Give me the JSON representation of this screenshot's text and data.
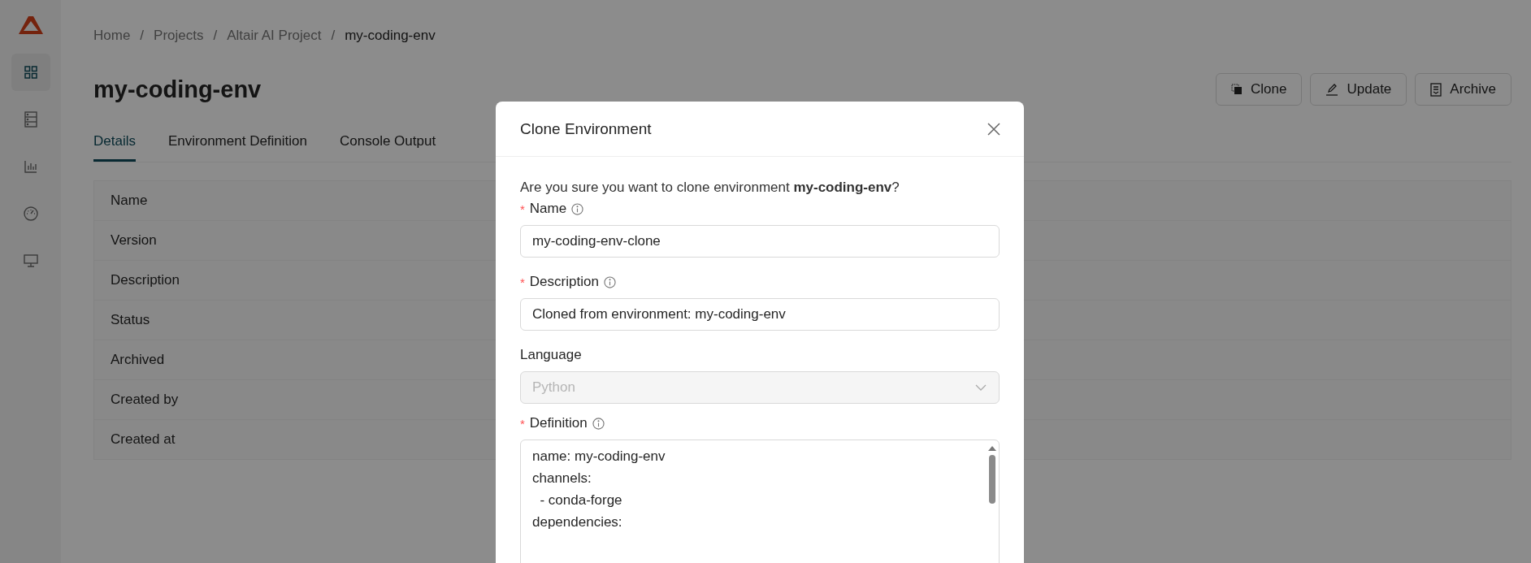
{
  "sidebar": {
    "items": [
      {
        "kind": "grid",
        "selected": true
      },
      {
        "kind": "server",
        "selected": false
      },
      {
        "kind": "chart",
        "selected": false
      },
      {
        "kind": "gauge",
        "selected": false
      },
      {
        "kind": "monitor",
        "selected": false
      }
    ]
  },
  "breadcrumb": {
    "separator": "/",
    "items": [
      "Home",
      "Projects",
      "Altair AI Project",
      "my-coding-env"
    ]
  },
  "title": "my-coding-env",
  "actions": [
    {
      "kind": "clone",
      "label": "Clone"
    },
    {
      "kind": "update",
      "label": "Update"
    },
    {
      "kind": "archive",
      "label": "Archive"
    }
  ],
  "tabs": [
    {
      "label": "Details",
      "selected": true
    },
    {
      "label": "Environment Definition",
      "selected": false
    },
    {
      "label": "Console Output",
      "selected": false
    }
  ],
  "details": {
    "rows": [
      "Name",
      "Version",
      "Description",
      "Status",
      "Archived",
      "Created by",
      "Created at"
    ]
  },
  "modal": {
    "title": "Clone Environment",
    "prompt": "Are you sure you want to clone environment **my-coding-env**?",
    "fields": [
      {
        "kind": "text",
        "label": "Name",
        "required_mark": "*",
        "info": true,
        "value": "my-coding-env-clone"
      },
      {
        "kind": "text",
        "label": "Description",
        "required_mark": "*",
        "info": true,
        "value": "Cloned from environment: my-coding-env"
      },
      {
        "kind": "select",
        "label": "Language",
        "value": "Python",
        "disabled": true
      },
      {
        "kind": "code",
        "label": "Definition",
        "required_mark": "*",
        "info": true,
        "lines": [
          "name: my-coding-env",
          "channels:",
          "  - conda-forge",
          "dependencies:"
        ]
      }
    ]
  }
}
